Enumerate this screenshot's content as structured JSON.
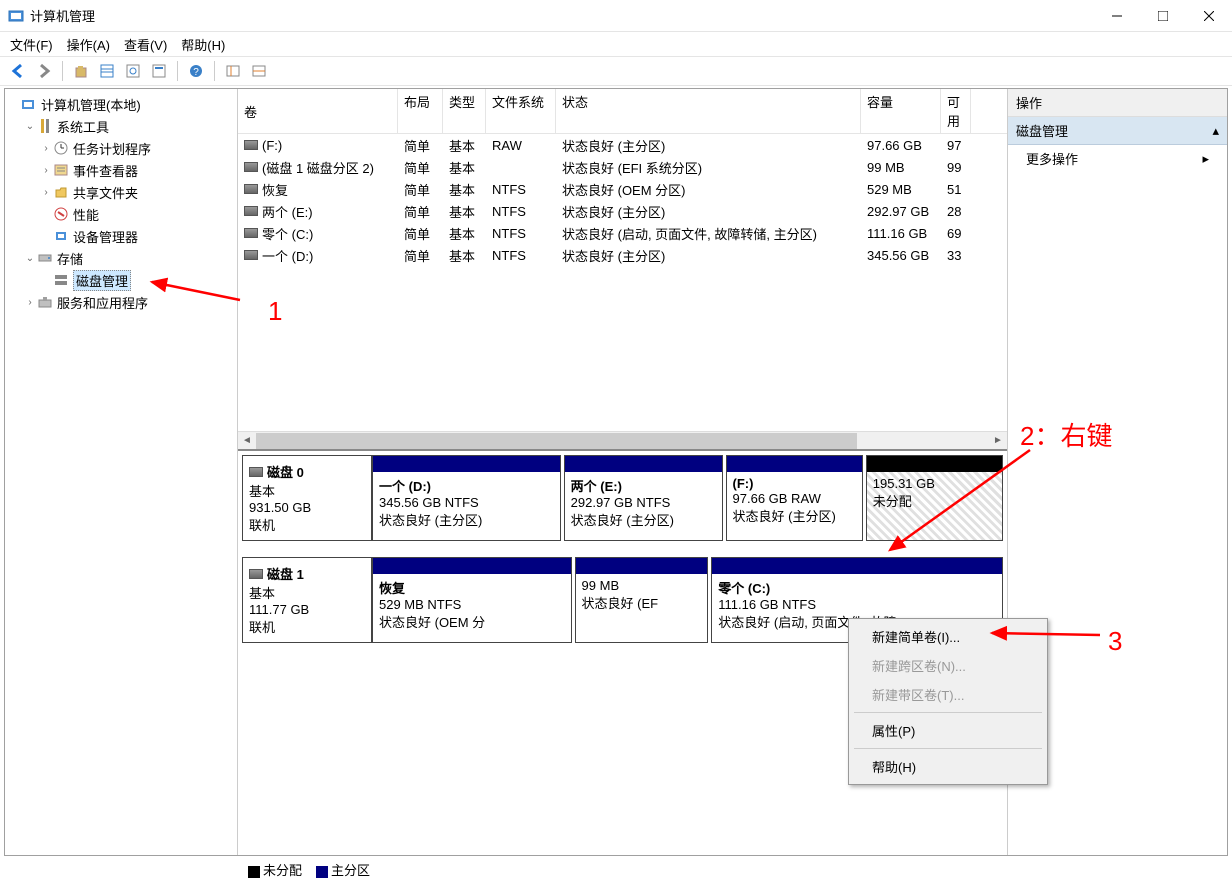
{
  "window": {
    "title": "计算机管理"
  },
  "menu": {
    "file": "文件(F)",
    "action": "操作(A)",
    "view": "查看(V)",
    "help": "帮助(H)"
  },
  "tree": {
    "root": "计算机管理(本地)",
    "systools": "系统工具",
    "scheduler": "任务计划程序",
    "eventviewer": "事件查看器",
    "shared": "共享文件夹",
    "perf": "性能",
    "devmgr": "设备管理器",
    "storage": "存储",
    "diskmgmt": "磁盘管理",
    "services": "服务和应用程序"
  },
  "table": {
    "headers": {
      "volume": "卷",
      "layout": "布局",
      "type": "类型",
      "fs": "文件系统",
      "status": "状态",
      "capacity": "容量",
      "free": "可用"
    },
    "rows": [
      {
        "name": "(F:)",
        "layout": "简单",
        "type": "基本",
        "fs": "RAW",
        "status": "状态良好 (主分区)",
        "cap": "97.66 GB",
        "free": "97"
      },
      {
        "name": "(磁盘 1 磁盘分区 2)",
        "layout": "简单",
        "type": "基本",
        "fs": "",
        "status": "状态良好 (EFI 系统分区)",
        "cap": "99 MB",
        "free": "99"
      },
      {
        "name": "恢复",
        "layout": "简单",
        "type": "基本",
        "fs": "NTFS",
        "status": "状态良好 (OEM 分区)",
        "cap": "529 MB",
        "free": "51"
      },
      {
        "name": "两个 (E:)",
        "layout": "简单",
        "type": "基本",
        "fs": "NTFS",
        "status": "状态良好 (主分区)",
        "cap": "292.97 GB",
        "free": "28"
      },
      {
        "name": "零个 (C:)",
        "layout": "简单",
        "type": "基本",
        "fs": "NTFS",
        "status": "状态良好 (启动, 页面文件, 故障转储, 主分区)",
        "cap": "111.16 GB",
        "free": "69"
      },
      {
        "name": "一个 (D:)",
        "layout": "简单",
        "type": "基本",
        "fs": "NTFS",
        "status": "状态良好 (主分区)",
        "cap": "345.56 GB",
        "free": "33"
      }
    ]
  },
  "disks": {
    "disk0": {
      "name": "磁盘 0",
      "type": "基本",
      "size": "931.50 GB",
      "status": "联机"
    },
    "disk1": {
      "name": "磁盘 1",
      "type": "基本",
      "size": "111.77 GB",
      "status": "联机"
    },
    "d0p1": {
      "name": "一个  (D:)",
      "size": "345.56 GB NTFS",
      "status": "状态良好 (主分区)"
    },
    "d0p2": {
      "name": "两个  (E:)",
      "size": "292.97 GB NTFS",
      "status": "状态良好 (主分区)"
    },
    "d0p3": {
      "name": " (F:)",
      "size": "97.66 GB RAW",
      "status": "状态良好 (主分区)"
    },
    "d0p4": {
      "name": "",
      "size": "195.31 GB",
      "status": "未分配"
    },
    "d1p1": {
      "name": "恢复",
      "size": "529 MB NTFS",
      "status": "状态良好 (OEM 分"
    },
    "d1p2": {
      "name": "",
      "size": "99 MB",
      "status": "状态良好 (EF"
    },
    "d1p3": {
      "name": "零个  (C:)",
      "size": "111.16 GB NTFS",
      "status": "状态良好 (启动, 页面文件, 故障"
    }
  },
  "legend": {
    "unalloc": "未分配",
    "primary": "主分区"
  },
  "actions": {
    "header": "操作",
    "section": "磁盘管理",
    "more": "更多操作"
  },
  "context": {
    "newSimple": "新建简单卷(I)...",
    "newSpan": "新建跨区卷(N)...",
    "newStripe": "新建带区卷(T)...",
    "props": "属性(P)",
    "help": "帮助(H)"
  },
  "annotations": {
    "a1": "1",
    "a2": "2：右键",
    "a3": "3"
  }
}
